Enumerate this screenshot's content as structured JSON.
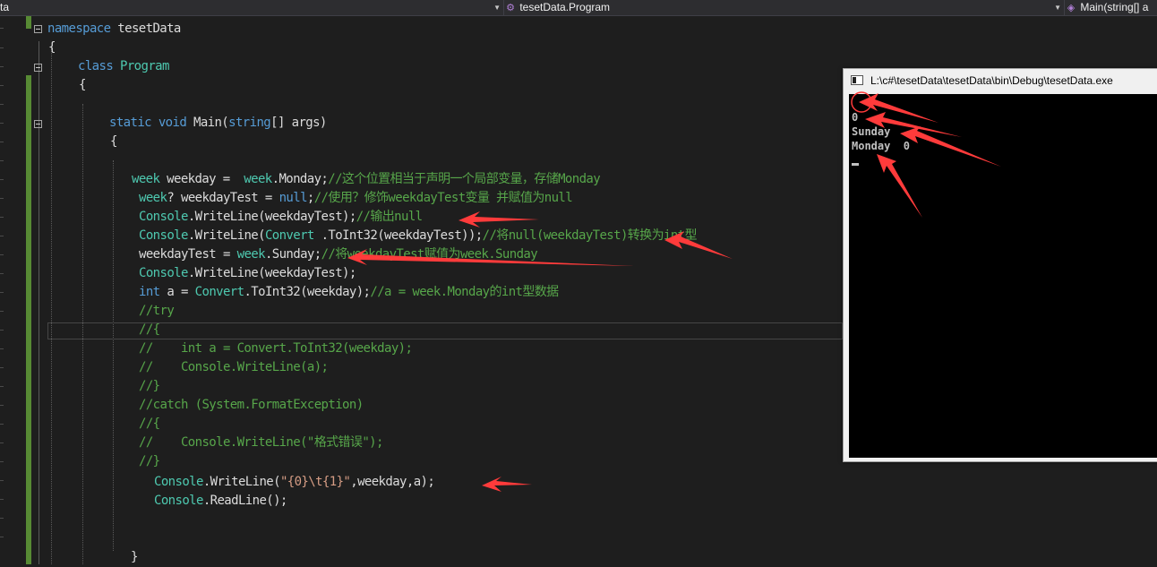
{
  "navbar": {
    "left_label": "ta",
    "middle_label": "tesetData.Program",
    "right_label": "Main(string[] a"
  },
  "code": {
    "line01": {
      "a": "namespace",
      "b": " tesetData"
    },
    "line02": {
      "a": "{"
    },
    "line03": {
      "a": "class",
      "b": "Program"
    },
    "line04": {
      "a": "{"
    },
    "line05": {
      "a": "static",
      "b": " ",
      "c": "void",
      "d": " Main(",
      "e": "string",
      "f": "[] args)"
    },
    "line06": {
      "a": "{"
    },
    "line07": {
      "a": "week",
      "b": " weekday =  ",
      "c": "week",
      "d": ".Monday;",
      "e": "//这个位置相当于声明一个局部变量，存储Monday"
    },
    "line08": {
      "a": "week",
      "b": "? weekdayTest = ",
      "c": "null",
      "d": ";",
      "e": "//使用？修饰weekdayTest变量 并赋值为null"
    },
    "line09": {
      "a": "Console",
      "b": ".WriteLine(weekdayTest);",
      "c": "//输出null"
    },
    "line10": {
      "a": "Console",
      "b": ".WriteLine(",
      "c": "Convert",
      "d": " .ToInt32(weekdayTest));",
      "e": "//将null(weekdayTest)转换为int型"
    },
    "line11": {
      "a": "weekdayTest = ",
      "b": "week",
      "c": ".Sunday;",
      "d": "//将weekdayTest赋值为week.Sunday"
    },
    "line12": {
      "a": "Console",
      "b": ".WriteLine(weekdayTest);"
    },
    "line13": {
      "a": "int",
      "b": " a = ",
      "c": "Convert",
      "d": ".ToInt32(weekday);",
      "e": "//a = week.Monday的int型数据"
    },
    "line14": {
      "a": "//try"
    },
    "line15": {
      "a": "//{"
    },
    "line16": {
      "a": "//    int a = Convert.ToInt32(weekday);"
    },
    "line17": {
      "a": "//    Console.WriteLine(a);"
    },
    "line18": {
      "a": "//}"
    },
    "line19": {
      "a": "//catch (System.FormatException)"
    },
    "line20": {
      "a": "//{"
    },
    "line21": {
      "a": "//    Console.WriteLine(\"格式错误\");"
    },
    "line22": {
      "a": "//}"
    },
    "line23": {
      "a": "Console",
      "b": ".WriteLine(",
      "c": "\"{0}\\t{1}\"",
      "d": ",weekday,a);"
    },
    "line24": {
      "a": "Console",
      "b": ".ReadLine();"
    },
    "line25": {
      "a": "}"
    }
  },
  "console": {
    "title": "L:\\c#\\tesetData\\tesetData\\bin\\Debug\\tesetData.exe",
    "output": [
      "",
      "0",
      "Sunday",
      "Monday  0"
    ]
  },
  "colors": {
    "editor_background": "#1e1e1e",
    "keyword": "#569cd6",
    "type": "#4ec9b0",
    "comment": "#57a64a",
    "string": "#d69d85",
    "annotation_arrow": "#ff3b3b"
  }
}
